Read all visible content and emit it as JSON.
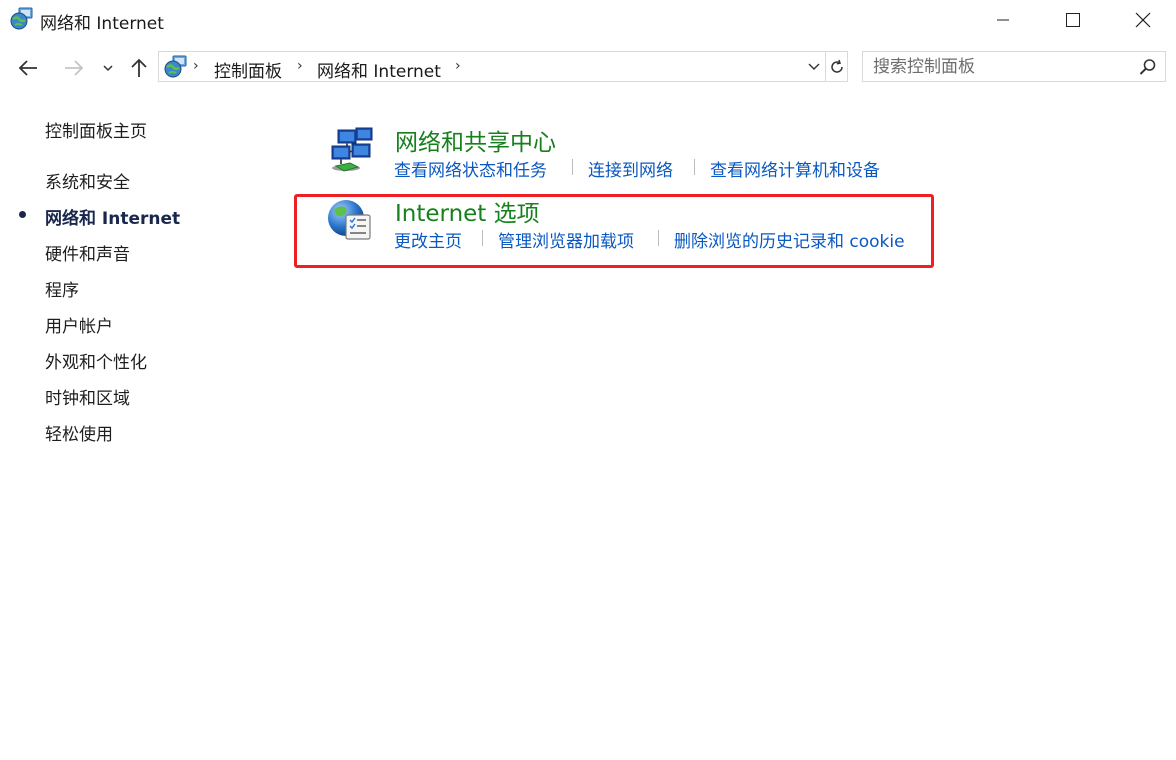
{
  "window": {
    "title": "网络和 Internet",
    "icon": "network-internet-icon"
  },
  "nav": {
    "back_icon": "arrow-left-icon",
    "forward_icon": "arrow-right-icon",
    "recent_icon": "chevron-down-icon",
    "up_icon": "arrow-up-icon"
  },
  "address": {
    "icon": "network-internet-icon",
    "breadcrumbs": [
      "控制面板",
      "网络和 Internet"
    ]
  },
  "search": {
    "placeholder": "搜索控制面板",
    "value": ""
  },
  "sidebar": {
    "home_label": "控制面板主页",
    "items": [
      {
        "label": "系统和安全",
        "active": false
      },
      {
        "label": "网络和 Internet",
        "active": true
      },
      {
        "label": "硬件和声音",
        "active": false
      },
      {
        "label": "程序",
        "active": false
      },
      {
        "label": "用户帐户",
        "active": false
      },
      {
        "label": "外观和个性化",
        "active": false
      },
      {
        "label": "时钟和区域",
        "active": false
      },
      {
        "label": "轻松使用",
        "active": false
      }
    ]
  },
  "categories": [
    {
      "title": "网络和共享中心",
      "icon": "network-sharing-center-icon",
      "tasks": [
        "查看网络状态和任务",
        "连接到网络",
        "查看网络计算机和设备"
      ]
    },
    {
      "title": "Internet 选项",
      "icon": "internet-options-icon",
      "tasks": [
        "更改主页",
        "管理浏览器加载项",
        "删除浏览的历史记录和 cookie"
      ],
      "highlighted": true
    }
  ],
  "colors": {
    "category_title": "#16811c",
    "task_link": "#0a58c2",
    "highlight_border": "#ec2025",
    "active_nav": "#19274d"
  }
}
